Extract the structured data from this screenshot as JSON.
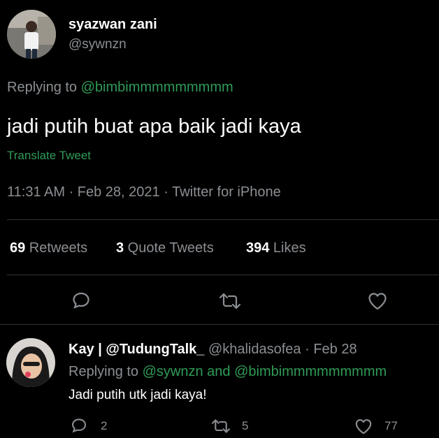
{
  "tweet": {
    "author_name": "syazwan zani",
    "author_handle": "@sywnzn",
    "replying_label": "Replying to ",
    "replying_to": "@bimbimmmmmmmmm",
    "text": "jadi putih buat apa baik jadi kaya",
    "translate_label": "Translate Tweet",
    "meta": "11:31 AM · Feb 28, 2021 · Twitter for iPhone",
    "stats": {
      "retweets_count": "69",
      "retweets_label": " Retweets",
      "quotes_count": "3",
      "quotes_label": " Quote Tweets",
      "likes_count": "394",
      "likes_label": " Likes"
    },
    "actions": [
      "reply-icon",
      "retweet-icon",
      "like-icon"
    ]
  },
  "reply": {
    "author_name": "Kay | @TudungTalk_",
    "author_handle": "@khalidasofea",
    "date": "· Feb 28",
    "replying_label": "Replying to ",
    "replying_to_1": "@sywnzn",
    "replying_and": " and ",
    "replying_to_2": "@bimbimmmmmmmmm",
    "text": "Jadi putih utk jadi kaya!",
    "reply_count": "2",
    "retweet_count": "5",
    "like_count": "77"
  },
  "colors": {
    "background": "#000000",
    "text": "#ffffff",
    "muted": "#8b8f93",
    "link": "#2f9b57",
    "divider": "#2f3336"
  }
}
